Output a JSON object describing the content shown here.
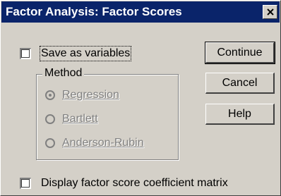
{
  "window": {
    "title": "Factor Analysis: Factor Scores",
    "close_symbol": "×"
  },
  "save_checkbox": {
    "label": "Save as variables",
    "checked": false
  },
  "method": {
    "group_label": "Method",
    "options": [
      {
        "label": "Regression",
        "selected": true,
        "enabled": false
      },
      {
        "label": "Bartlett",
        "selected": false,
        "enabled": false
      },
      {
        "label": "Anderson-Rubin",
        "selected": false,
        "enabled": false
      }
    ]
  },
  "display_checkbox": {
    "label": "Display factor score coefficient matrix",
    "checked": false
  },
  "buttons": {
    "continue": "Continue",
    "cancel": "Cancel",
    "help": "Help"
  },
  "colors": {
    "title_bar": "#0a246a",
    "dialog_face": "#d4d0c8",
    "disabled_text": "#808080"
  }
}
